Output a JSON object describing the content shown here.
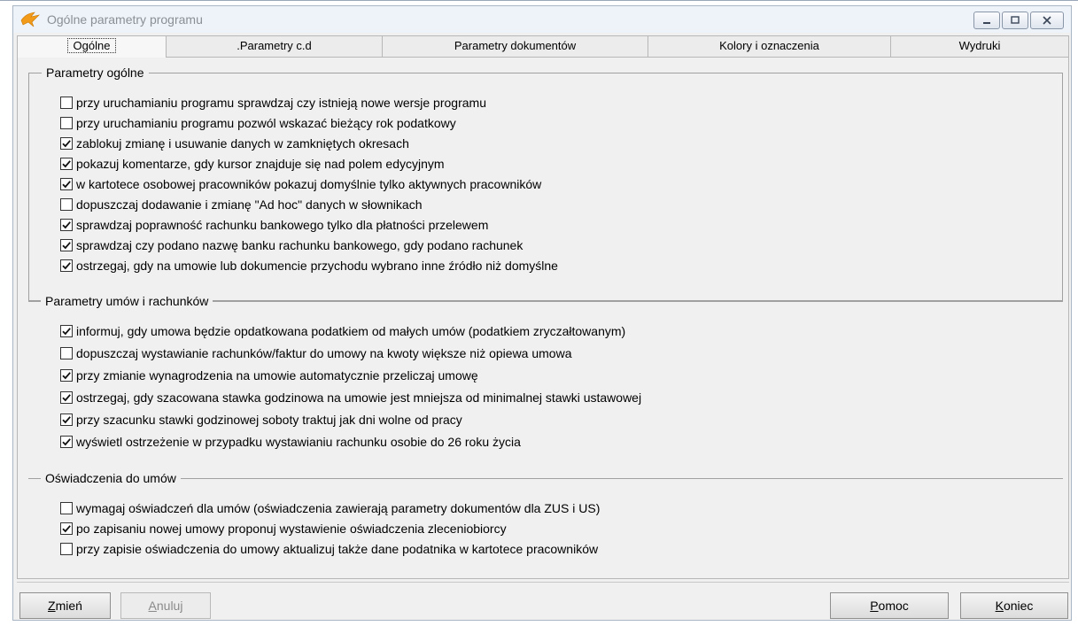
{
  "window": {
    "title": "Ogólne parametry programu",
    "accent": "#f29a1a"
  },
  "tabs": [
    {
      "label": "Ogólne",
      "active": true
    },
    {
      "label": ".Parametry c.d"
    },
    {
      "label": "Parametry dokumentów"
    },
    {
      "label": "Kolory i oznaczenia"
    },
    {
      "label": "Wydruki"
    }
  ],
  "groups": {
    "general": {
      "title": "Parametry ogólne",
      "options": [
        {
          "label": "przy uruchamianiu programu sprawdzaj czy istnieją nowe wersje programu",
          "checked": false
        },
        {
          "label": "przy uruchamianiu programu pozwól wskazać bieżący rok podatkowy",
          "checked": false
        },
        {
          "label": "zablokuj zmianę i usuwanie danych w zamkniętych okresach",
          "checked": true
        },
        {
          "label": "pokazuj komentarze, gdy kursor znajduje się nad polem edycyjnym",
          "checked": true
        },
        {
          "label": "w kartotece osobowej pracowników pokazuj domyślnie tylko aktywnych pracowników",
          "checked": true
        },
        {
          "label": "dopuszczaj dodawanie i zmianę \"Ad hoc\" danych w słownikach",
          "checked": false
        },
        {
          "label": "sprawdzaj poprawność rachunku bankowego tylko dla płatności przelewem",
          "checked": true
        },
        {
          "label": "sprawdzaj czy podano nazwę banku rachunku bankowego, gdy podano rachunek",
          "checked": true
        },
        {
          "label": "ostrzegaj, gdy na umowie lub dokumencie przychodu wybrano inne źródło niż domyślne",
          "checked": true
        }
      ]
    },
    "contracts": {
      "title": "Parametry umów i rachunków",
      "options": [
        {
          "label": "informuj, gdy umowa będzie opdatkowana podatkiem od małych umów (podatkiem zryczałtowanym)",
          "checked": true
        },
        {
          "label": "dopuszczaj wystawianie rachunków/faktur do umowy na kwoty większe niż opiewa umowa",
          "checked": false
        },
        {
          "label": "przy zmianie wynagrodzenia na umowie automatycznie przeliczaj umowę",
          "checked": true
        },
        {
          "label": "ostrzegaj, gdy szacowana stawka godzinowa na umowie jest mniejsza od minimalnej stawki ustawowej",
          "checked": true
        },
        {
          "label": "przy szacunku stawki godzinowej soboty traktuj jak dni wolne od pracy",
          "checked": true
        },
        {
          "label": "wyświetl ostrzeżenie w przypadku wystawianiu rachunku osobie do 26 roku życia",
          "checked": true
        }
      ]
    },
    "statements": {
      "title": "Oświadczenia do umów",
      "options": [
        {
          "label": "wymagaj oświadczeń dla umów (oświadczenia zawierają parametry dokumentów dla ZUS i US)",
          "checked": false
        },
        {
          "label": "po zapisaniu nowej umowy proponuj wystawienie oświadczenia zleceniobiorcy",
          "checked": true
        },
        {
          "label": "przy zapisie oświadczenia do umowy aktualizuj także dane podatnika w kartotece pracowników",
          "checked": false
        }
      ]
    }
  },
  "buttons": {
    "change": {
      "first": "Z",
      "rest": "mień"
    },
    "cancel": {
      "first": "A",
      "rest": "nuluj",
      "disabled": true
    },
    "help": {
      "first": "P",
      "rest": "omoc"
    },
    "close": {
      "first": "K",
      "rest": "oniec"
    }
  }
}
